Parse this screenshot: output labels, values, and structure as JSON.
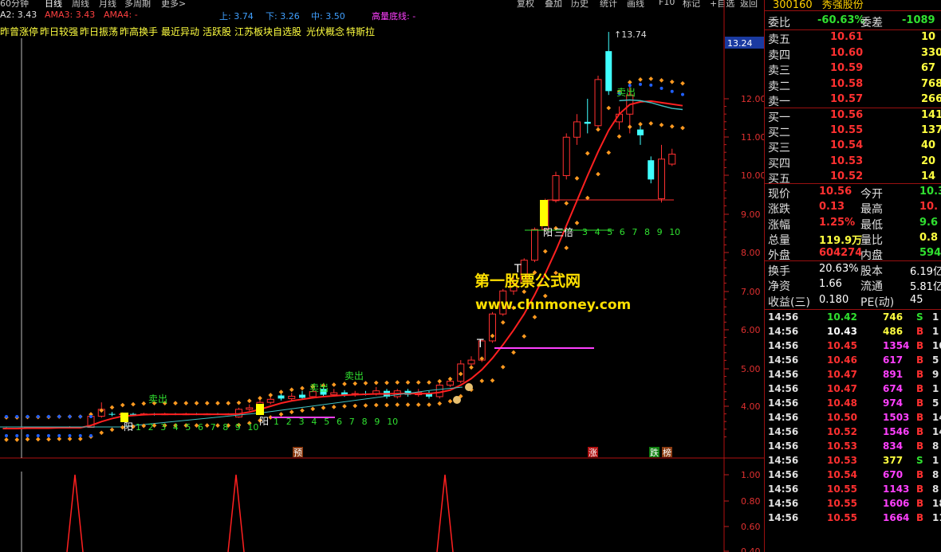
{
  "toolbar": {
    "left_tabs": [
      "60分钟",
      "日线",
      "周线",
      "月线",
      "多周期",
      "更多>"
    ],
    "right_buttons": [
      "复权",
      "叠加",
      "历史",
      "统计",
      "画线",
      "F10",
      "标记",
      "+自选",
      "返回"
    ]
  },
  "indicators": {
    "ama2": "A2: 3.43",
    "ama3": "AMA3: 3.43",
    "ama4": "AMA4: -",
    "up": "上: 3.74",
    "down": "下: 3.26",
    "mid": "中: 3.50",
    "bottom_line": "高量底线: -"
  },
  "categories": [
    "昨曾涨停",
    "昨日较强",
    "昨日振荡",
    "昨高换手",
    "最近异动",
    "活跃股",
    "江苏板块自选股",
    "光伏概念",
    "特斯拉"
  ],
  "price_axis": {
    "current_price_tag": "13.24",
    "ticks": [
      "12.00",
      "11.00",
      "10.00",
      "9.00",
      "8.00",
      "7.00",
      "6.00",
      "5.00",
      "4.00"
    ]
  },
  "lower_axis": {
    "ticks": [
      "1.00",
      "0.80",
      "0.60",
      "0.40"
    ]
  },
  "chart_labels": {
    "high_marker": "13.74",
    "sell_signal": "卖出",
    "yang": "阳",
    "triple": "三倍",
    "count_ticks": [
      "3",
      "4",
      "5",
      "6",
      "7",
      "8",
      "9",
      "10"
    ],
    "count_ticks_b": [
      "1",
      "2",
      "3",
      "4",
      "5",
      "6",
      "7",
      "8",
      "9",
      "10"
    ],
    "t_marker": "T",
    "badges": [
      {
        "text": "预",
        "color": "#8a3a10"
      },
      {
        "text": "涨",
        "color": "#b01010"
      },
      {
        "text": "跌",
        "color": "#108010"
      },
      {
        "text": "榜",
        "color": "#8a3a10"
      }
    ]
  },
  "watermark": {
    "line1": "第一股票公式网",
    "line2": "www.chnmoney.com"
  },
  "stock": {
    "code": "300160",
    "name": "秀强股份"
  },
  "order_book": {
    "weibi": {
      "label": "委比",
      "value": "-60.63%",
      "label2": "委差",
      "value2": "-1089"
    },
    "asks": [
      {
        "label": "卖五",
        "price": "10.61",
        "vol": "10"
      },
      {
        "label": "卖四",
        "price": "10.60",
        "vol": "330"
      },
      {
        "label": "卖三",
        "price": "10.59",
        "vol": "67"
      },
      {
        "label": "卖二",
        "price": "10.58",
        "vol": "768"
      },
      {
        "label": "卖一",
        "price": "10.57",
        "vol": "266"
      }
    ],
    "bids": [
      {
        "label": "买一",
        "price": "10.56",
        "vol": "141"
      },
      {
        "label": "买二",
        "price": "10.55",
        "vol": "137"
      },
      {
        "label": "买三",
        "price": "10.54",
        "vol": "40"
      },
      {
        "label": "买四",
        "price": "10.53",
        "vol": "20"
      },
      {
        "label": "买五",
        "price": "10.52",
        "vol": "14"
      }
    ]
  },
  "quote": [
    {
      "l1": "现价",
      "v1": "10.56",
      "c1": "red",
      "l2": "今开",
      "v2": "10.3",
      "c2": "green"
    },
    {
      "l1": "涨跌",
      "v1": "0.13",
      "c1": "red",
      "l2": "最高",
      "v2": "10.",
      "c2": "red"
    },
    {
      "l1": "涨幅",
      "v1": "1.25%",
      "c1": "red",
      "l2": "最低",
      "v2": "9.6",
      "c2": "green"
    },
    {
      "l1": "总量",
      "v1": "119.9万",
      "c1": "yellow",
      "l2": "量比",
      "v2": "0.8",
      "c2": "yellow"
    },
    {
      "l1": "外盘",
      "v1": "604274",
      "c1": "red",
      "l2": "内盘",
      "v2": "59460",
      "c2": "green"
    }
  ],
  "fundamentals": [
    {
      "l1": "换手",
      "v1": "20.63%",
      "l2": "股本",
      "v2": "6.19亿"
    },
    {
      "l1": "净资",
      "v1": "1.66",
      "l2": "流通",
      "v2": "5.81亿"
    },
    {
      "l1": "收益(三)",
      "v1": "0.180",
      "l2": "PE(动)",
      "v2": "45"
    }
  ],
  "ticks": [
    {
      "time": "14:56",
      "price": "10.42",
      "pc": "green",
      "vol": "746",
      "vc": "yellow",
      "side": "S",
      "sc": "green",
      "extra": "1"
    },
    {
      "time": "14:56",
      "price": "10.43",
      "pc": "white",
      "vol": "486",
      "vc": "yellow",
      "side": "B",
      "sc": "red",
      "extra": "1"
    },
    {
      "time": "14:56",
      "price": "10.45",
      "pc": "red",
      "vol": "1354",
      "vc": "mag",
      "side": "B",
      "sc": "red",
      "extra": "10"
    },
    {
      "time": "14:56",
      "price": "10.46",
      "pc": "red",
      "vol": "617",
      "vc": "mag",
      "side": "B",
      "sc": "red",
      "extra": "5"
    },
    {
      "time": "14:56",
      "price": "10.47",
      "pc": "red",
      "vol": "891",
      "vc": "mag",
      "side": "B",
      "sc": "red",
      "extra": "9"
    },
    {
      "time": "14:56",
      "price": "10.47",
      "pc": "red",
      "vol": "674",
      "vc": "mag",
      "side": "B",
      "sc": "red",
      "extra": "1"
    },
    {
      "time": "14:56",
      "price": "10.48",
      "pc": "red",
      "vol": "974",
      "vc": "mag",
      "side": "B",
      "sc": "red",
      "extra": "5"
    },
    {
      "time": "14:56",
      "price": "10.50",
      "pc": "red",
      "vol": "1503",
      "vc": "mag",
      "side": "B",
      "sc": "red",
      "extra": "14"
    },
    {
      "time": "14:56",
      "price": "10.52",
      "pc": "red",
      "vol": "1546",
      "vc": "mag",
      "side": "B",
      "sc": "red",
      "extra": "14"
    },
    {
      "time": "14:56",
      "price": "10.53",
      "pc": "red",
      "vol": "834",
      "vc": "mag",
      "side": "B",
      "sc": "red",
      "extra": "8"
    },
    {
      "time": "14:56",
      "price": "10.53",
      "pc": "red",
      "vol": "377",
      "vc": "yellow",
      "side": "S",
      "sc": "green",
      "extra": "1"
    },
    {
      "time": "14:56",
      "price": "10.54",
      "pc": "red",
      "vol": "670",
      "vc": "mag",
      "side": "B",
      "sc": "red",
      "extra": "8"
    },
    {
      "time": "14:56",
      "price": "10.55",
      "pc": "red",
      "vol": "1143",
      "vc": "mag",
      "side": "B",
      "sc": "red",
      "extra": "8"
    },
    {
      "time": "14:56",
      "price": "10.55",
      "pc": "red",
      "vol": "1606",
      "vc": "mag",
      "side": "B",
      "sc": "red",
      "extra": "18"
    },
    {
      "time": "14:56",
      "price": "10.55",
      "pc": "red",
      "vol": "1664",
      "vc": "mag",
      "side": "B",
      "sc": "red",
      "extra": "11"
    }
  ],
  "chart_data": {
    "type": "candlestick",
    "price_range": [
      3.0,
      13.74
    ],
    "candles": [
      {
        "o": 3.42,
        "c": 3.43,
        "h": 3.45,
        "l": 3.4
      },
      {
        "o": 3.43,
        "c": 3.42,
        "h": 3.44,
        "l": 3.4
      },
      {
        "o": 3.42,
        "c": 3.44,
        "h": 3.46,
        "l": 3.41
      },
      {
        "o": 3.44,
        "c": 3.43,
        "h": 3.45,
        "l": 3.41
      },
      {
        "o": 3.43,
        "c": 3.45,
        "h": 3.47,
        "l": 3.42
      },
      {
        "o": 3.45,
        "c": 3.44,
        "h": 3.46,
        "l": 3.42
      },
      {
        "o": 3.44,
        "c": 3.46,
        "h": 3.48,
        "l": 3.43
      },
      {
        "o": 3.46,
        "c": 3.45,
        "h": 3.47,
        "l": 3.43
      },
      {
        "o": 3.45,
        "c": 3.74,
        "h": 3.76,
        "l": 3.44
      },
      {
        "o": 3.74,
        "c": 3.92,
        "h": 4.1,
        "l": 3.7
      },
      {
        "o": 3.8,
        "c": 3.78,
        "h": 3.85,
        "l": 3.74
      },
      {
        "o": 3.78,
        "c": 3.8,
        "h": 3.84,
        "l": 3.75
      },
      {
        "o": 3.8,
        "c": 3.79,
        "h": 3.83,
        "l": 3.76
      },
      {
        "o": 3.79,
        "c": 3.8,
        "h": 3.83,
        "l": 3.76
      },
      {
        "o": 3.8,
        "c": 3.79,
        "h": 3.82,
        "l": 3.76
      },
      {
        "o": 3.79,
        "c": 3.8,
        "h": 3.83,
        "l": 3.77
      },
      {
        "o": 3.8,
        "c": 3.79,
        "h": 3.82,
        "l": 3.77
      },
      {
        "o": 3.79,
        "c": 3.8,
        "h": 3.83,
        "l": 3.77
      },
      {
        "o": 3.8,
        "c": 3.79,
        "h": 3.82,
        "l": 3.77
      },
      {
        "o": 3.79,
        "c": 3.8,
        "h": 3.82,
        "l": 3.77
      },
      {
        "o": 3.8,
        "c": 3.79,
        "h": 3.82,
        "l": 3.77
      },
      {
        "o": 3.79,
        "c": 3.8,
        "h": 3.82,
        "l": 3.77
      },
      {
        "o": 3.72,
        "c": 3.92,
        "h": 3.96,
        "l": 3.7
      },
      {
        "o": 3.92,
        "c": 3.96,
        "h": 4.05,
        "l": 3.88
      },
      {
        "o": 3.96,
        "c": 4.1,
        "h": 4.2,
        "l": 3.95
      },
      {
        "o": 4.1,
        "c": 4.18,
        "h": 4.3,
        "l": 4.05
      },
      {
        "o": 4.28,
        "c": 4.2,
        "h": 4.4,
        "l": 4.15
      },
      {
        "o": 4.2,
        "c": 4.26,
        "h": 4.35,
        "l": 4.15
      },
      {
        "o": 4.3,
        "c": 4.22,
        "h": 4.4,
        "l": 4.2
      },
      {
        "o": 4.25,
        "c": 4.38,
        "h": 4.45,
        "l": 4.2
      },
      {
        "o": 4.45,
        "c": 4.3,
        "h": 4.55,
        "l": 4.25
      },
      {
        "o": 4.3,
        "c": 4.35,
        "h": 4.45,
        "l": 4.25
      },
      {
        "o": 4.36,
        "c": 4.3,
        "h": 4.42,
        "l": 4.25
      },
      {
        "o": 4.3,
        "c": 4.33,
        "h": 4.4,
        "l": 4.25
      },
      {
        "o": 4.33,
        "c": 4.32,
        "h": 4.4,
        "l": 4.28
      },
      {
        "o": 4.32,
        "c": 4.4,
        "h": 4.5,
        "l": 4.28
      },
      {
        "o": 4.4,
        "c": 4.25,
        "h": 4.45,
        "l": 4.2
      },
      {
        "o": 4.25,
        "c": 4.4,
        "h": 4.45,
        "l": 4.2
      },
      {
        "o": 4.4,
        "c": 4.3,
        "h": 4.45,
        "l": 4.25
      },
      {
        "o": 4.3,
        "c": 4.36,
        "h": 4.45,
        "l": 4.25
      },
      {
        "o": 4.35,
        "c": 4.25,
        "h": 4.4,
        "l": 4.2
      },
      {
        "o": 4.25,
        "c": 4.55,
        "h": 4.6,
        "l": 4.2
      },
      {
        "o": 4.55,
        "c": 4.65,
        "h": 4.7,
        "l": 4.5
      },
      {
        "o": 4.65,
        "c": 5.1,
        "h": 5.2,
        "l": 4.6
      },
      {
        "o": 5.1,
        "c": 5.2,
        "h": 5.3,
        "l": 5.0
      },
      {
        "o": 5.2,
        "c": 5.7,
        "h": 5.75,
        "l": 5.15
      },
      {
        "o": 5.7,
        "c": 6.4,
        "h": 6.45,
        "l": 5.65
      },
      {
        "o": 6.4,
        "c": 7.0,
        "h": 7.05,
        "l": 6.35
      },
      {
        "o": 7.0,
        "c": 7.2,
        "h": 7.35,
        "l": 6.9
      },
      {
        "o": 7.2,
        "c": 7.8,
        "h": 7.85,
        "l": 7.15
      },
      {
        "o": 7.8,
        "c": 8.6,
        "h": 8.65,
        "l": 7.75
      },
      {
        "o": 8.6,
        "c": 9.35,
        "h": 9.4,
        "l": 8.55
      },
      {
        "o": 9.35,
        "c": 10.0,
        "h": 10.1,
        "l": 9.3
      },
      {
        "o": 10.0,
        "c": 11.0,
        "h": 11.1,
        "l": 9.9
      },
      {
        "o": 11.0,
        "c": 11.4,
        "h": 11.6,
        "l": 10.8
      },
      {
        "o": 11.4,
        "c": 11.35,
        "h": 12.0,
        "l": 11.1
      },
      {
        "o": 11.3,
        "c": 12.5,
        "h": 12.6,
        "l": 11.2
      },
      {
        "o": 13.24,
        "c": 12.2,
        "h": 13.74,
        "l": 12.1
      },
      {
        "o": 11.4,
        "c": 11.6,
        "h": 11.8,
        "l": 11.2
      },
      {
        "o": 11.6,
        "c": 12.1,
        "h": 12.4,
        "l": 11.1
      },
      {
        "o": 11.2,
        "c": 11.05,
        "h": 11.3,
        "l": 10.8
      },
      {
        "o": 10.4,
        "c": 9.9,
        "h": 10.5,
        "l": 9.8
      },
      {
        "o": 9.4,
        "c": 10.43,
        "h": 10.8,
        "l": 9.3
      },
      {
        "o": 10.3,
        "c": 10.56,
        "h": 10.7,
        "l": 10.25
      }
    ],
    "ma_red": [
      3.42,
      3.42,
      3.43,
      3.43,
      3.43,
      3.44,
      3.44,
      3.44,
      3.5,
      3.6,
      3.68,
      3.74,
      3.76,
      3.78,
      3.79,
      3.79,
      3.79,
      3.79,
      3.79,
      3.79,
      3.79,
      3.79,
      3.8,
      3.85,
      3.92,
      4.0,
      4.08,
      4.14,
      4.18,
      4.22,
      4.25,
      4.27,
      4.29,
      4.3,
      4.31,
      4.32,
      4.32,
      4.33,
      4.33,
      4.33,
      4.33,
      4.36,
      4.42,
      4.55,
      4.72,
      4.95,
      5.25,
      5.6,
      5.98,
      6.4,
      6.9,
      7.45,
      8.05,
      8.7,
      9.35,
      10.0,
      10.62,
      11.18,
      11.6,
      11.85,
      11.92,
      11.94,
      11.9,
      11.86,
      11.82
    ],
    "ma_cyan_start": 58
  }
}
